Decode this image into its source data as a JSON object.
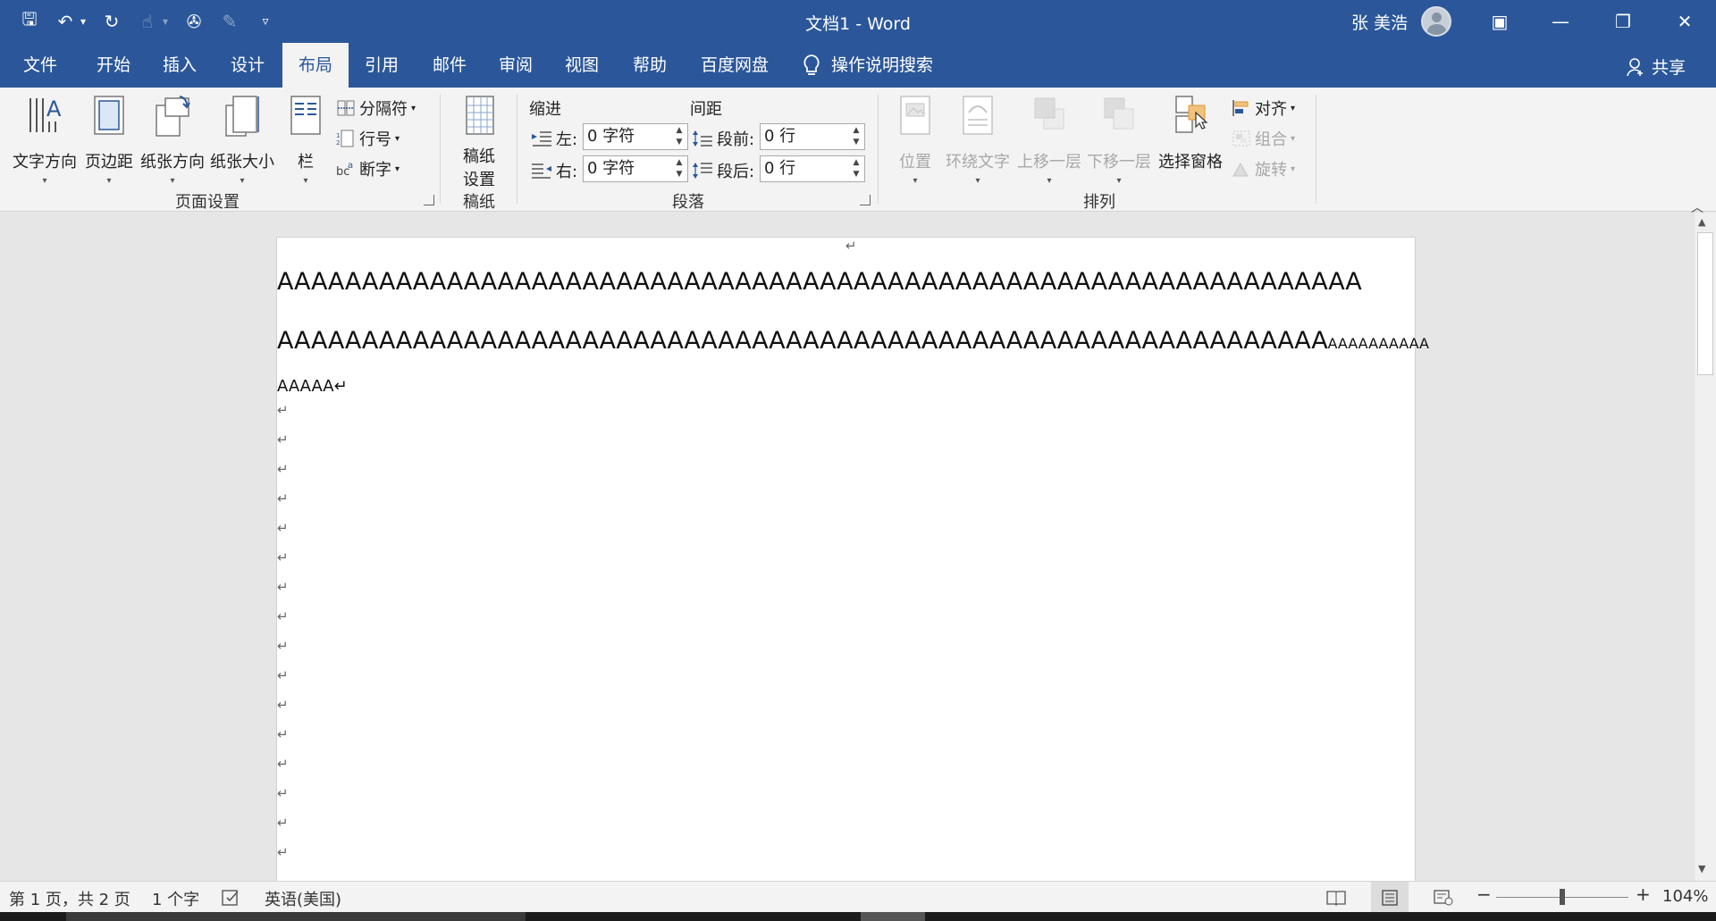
{
  "window": {
    "title": "文档1  -  Word",
    "user_name": "张 美浩",
    "controls": {
      "ribbon_display": "▣",
      "minimize": "—",
      "restore": "❐",
      "close": "✕"
    }
  },
  "quick_access": [
    {
      "name": "save-icon",
      "glyph": "🖫"
    },
    {
      "name": "undo-icon",
      "glyph": "↶"
    },
    {
      "name": "undo-dropdown-icon",
      "glyph": "▾"
    },
    {
      "name": "repeat-icon",
      "glyph": "↻"
    },
    {
      "name": "touch-mode-icon",
      "glyph": "☝"
    },
    {
      "name": "qat-dropdown-icon",
      "glyph": "▾"
    },
    {
      "name": "theme-icon",
      "glyph": "✇"
    },
    {
      "name": "draw-icon",
      "glyph": "✎"
    },
    {
      "name": "customize-qat-icon",
      "glyph": "▿"
    }
  ],
  "tabs": [
    "文件",
    "开始",
    "插入",
    "设计",
    "布局",
    "引用",
    "邮件",
    "审阅",
    "视图",
    "帮助",
    "百度网盘"
  ],
  "active_tab": "布局",
  "tell_me": "操作说明搜索",
  "share": "共享",
  "ribbon": {
    "page_setup": {
      "label": "页面设置",
      "text_direction": "文字方向",
      "margins": "页边距",
      "orientation": "纸张方向",
      "size": "纸张大小",
      "columns": "栏",
      "breaks": "分隔符",
      "line_numbers": "行号",
      "hyphenation": "断字"
    },
    "draft": {
      "label": "稿纸",
      "setup_line1": "稿纸",
      "setup_line2": "设置"
    },
    "paragraph": {
      "label": "段落",
      "indent_heading": "缩进",
      "spacing_heading": "间距",
      "left_label": "左:",
      "left_value": "0 字符",
      "right_label": "右:",
      "right_value": "0 字符",
      "before_label": "段前:",
      "before_value": "0 行",
      "after_label": "段后:",
      "after_value": "0 行"
    },
    "arrange": {
      "label": "排列",
      "position": "位置",
      "wrap_text": "环绕文字",
      "bring_forward": "上移一层",
      "send_backward": "下移一层",
      "selection_pane": "选择窗格",
      "align": "对齐",
      "group": "组合",
      "rotate": "旋转"
    }
  },
  "document": {
    "header_mark": "↵",
    "line1": "AAAAAAAAAAAAAAAAAAAAAAAAAAAAAAAAAAAAAAAAAAAAAAAAAAAAAAAAAAAAAAAA",
    "line2_large": "AAAAAAAAAAAAAAAAAAAAAAAAAAAAAAAAAAAAAAAAAAAAAAAAAAAAAAAAAAAAAA",
    "line2_small": "AAAAAAAAAA",
    "line3": "AAAAA↵",
    "paragraph_mark": "↵"
  },
  "status_bar": {
    "page": "第 1 页，共 2 页",
    "words": "1 个字",
    "language": "英语(美国)",
    "zoom_minus": "−",
    "zoom_plus": "+",
    "zoom": "104%"
  },
  "colors": {
    "accent": "#2b579a",
    "ribbon": "#f3f3f3",
    "canvas": "#e6e6e6"
  }
}
